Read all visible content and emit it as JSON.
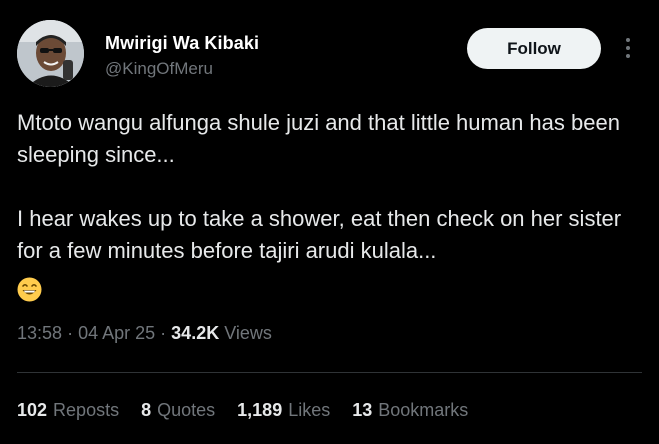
{
  "author": {
    "name": "Mwirigi Wa Kibaki",
    "handle": "@KingOfMeru",
    "avatar_icon": "person-avatar"
  },
  "actions": {
    "follow_label": "Follow",
    "more_icon": "more-vertical-icon"
  },
  "tweet": {
    "paragraph_1": "Mtoto wangu alfunga shule juzi and that little human has been sleeping since...",
    "paragraph_2": "I hear wakes up to take a shower, eat then check on her sister for a few minutes before tajiri arudi kulala...",
    "emoji": "grinning-face-emoji"
  },
  "meta": {
    "time": "13:58",
    "separator": "·",
    "date": "04 Apr 25",
    "views_count": "34.2K",
    "views_label": "Views"
  },
  "stats": [
    {
      "count": "102",
      "label": "Reposts"
    },
    {
      "count": "8",
      "label": "Quotes"
    },
    {
      "count": "1,189",
      "label": "Likes"
    },
    {
      "count": "13",
      "label": "Bookmarks"
    }
  ],
  "colors": {
    "background": "#000000",
    "text_primary": "#e7e9ea",
    "text_secondary": "#71767b",
    "follow_bg": "#eff3f4",
    "divider": "#2f3336"
  }
}
